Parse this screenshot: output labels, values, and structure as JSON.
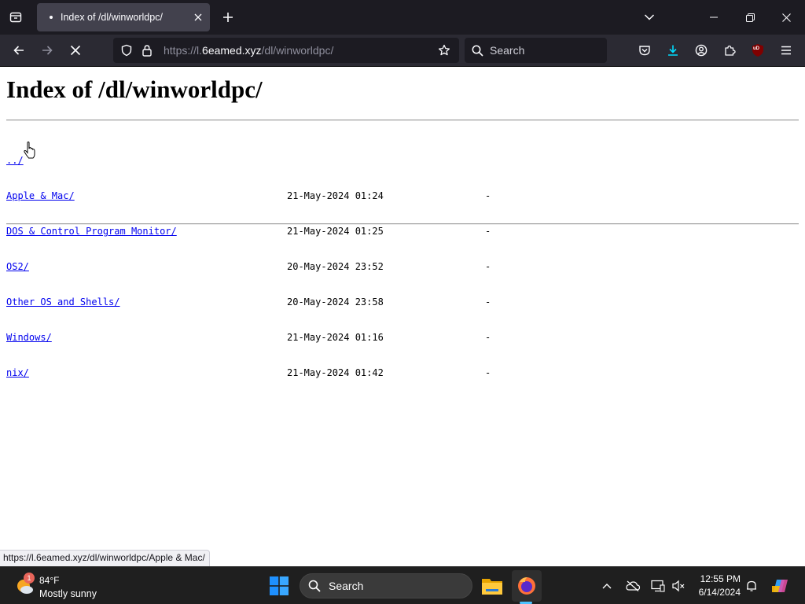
{
  "browser": {
    "tab": {
      "title": "Index of /dl/winworldpc/"
    },
    "url": {
      "scheme": "https://l.",
      "host": "6eamed.xyz",
      "path": "/dl/winworldpc/"
    },
    "search_placeholder": "Search",
    "status_url": "https://l.6eamed.xyz/dl/winworldpc/Apple & Mac/",
    "ublock_badge": "uD"
  },
  "page": {
    "title": "Index of /dl/winworldpc/",
    "parent_link": "../",
    "entries": [
      {
        "name": "Apple & Mac/",
        "date": "21-May-2024 01:24",
        "size": "-"
      },
      {
        "name": "DOS & Control Program Monitor/",
        "date": "21-May-2024 01:25",
        "size": "-"
      },
      {
        "name": "OS2/",
        "date": "20-May-2024 23:52",
        "size": "-"
      },
      {
        "name": "Other OS and Shells/",
        "date": "20-May-2024 23:58",
        "size": "-"
      },
      {
        "name": "Windows/",
        "date": "21-May-2024 01:16",
        "size": "-"
      },
      {
        "name": "nix/",
        "date": "21-May-2024 01:42",
        "size": "-"
      }
    ]
  },
  "taskbar": {
    "weather": {
      "temp": "84°F",
      "condition": "Mostly sunny",
      "badge": "1"
    },
    "search_label": "Search",
    "clock": {
      "time": "12:55 PM",
      "date": "6/14/2024"
    }
  },
  "colors": {
    "link": "#0000ee",
    "download_accent": "#00ddff",
    "taskbar_indicator": "#4cc2ff"
  }
}
